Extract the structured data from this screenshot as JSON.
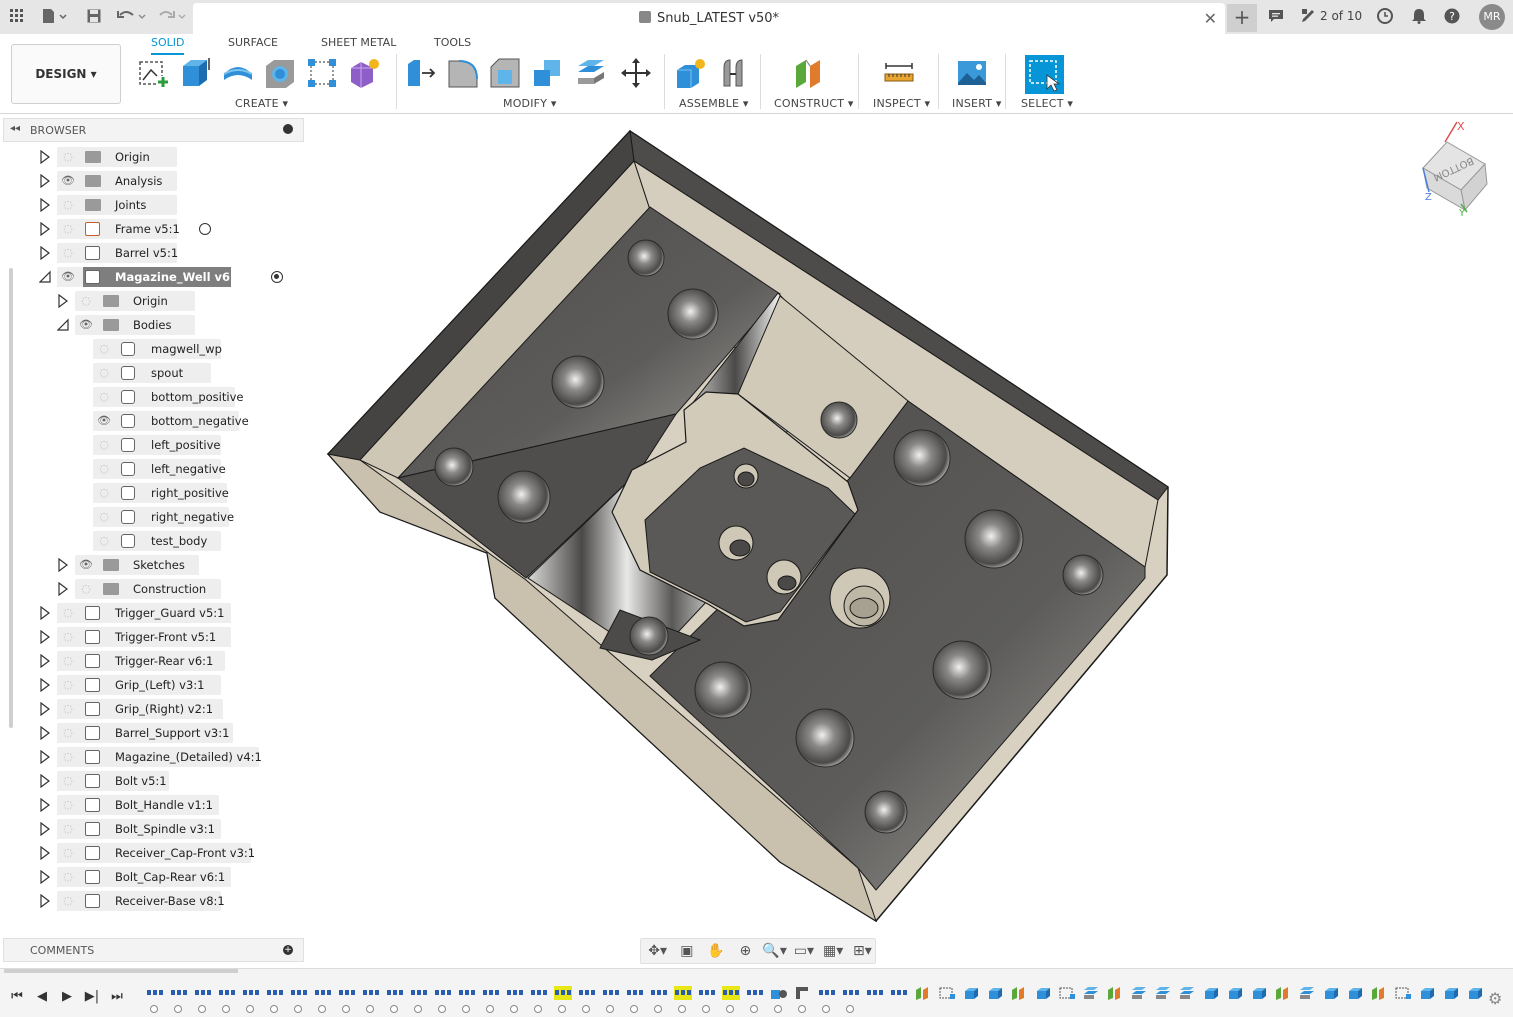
{
  "titlebar": {
    "doc_title": "Snub_LATEST v50*",
    "page_count": "2 of 10",
    "avatar_initials": "MR"
  },
  "ribbon": {
    "workspace": "DESIGN",
    "tabs": [
      "SOLID",
      "SURFACE",
      "SHEET METAL",
      "TOOLS"
    ],
    "active_tab": "SOLID",
    "groups": {
      "create": "CREATE",
      "modify": "MODIFY",
      "assemble": "ASSEMBLE",
      "construct": "CONSTRUCT",
      "inspect": "INSPECT",
      "insert": "INSERT",
      "select": "SELECT"
    }
  },
  "browser": {
    "title": "BROWSER",
    "items": [
      {
        "label": "Origin",
        "icon": "folder",
        "visible": false
      },
      {
        "label": "Analysis",
        "icon": "folder",
        "visible": true
      },
      {
        "label": "Joints",
        "icon": "folder",
        "visible": false
      },
      {
        "label": "Frame v5:1",
        "icon": "component-linked",
        "visible": false
      },
      {
        "label": "Barrel v5:1",
        "icon": "component",
        "visible": false
      },
      {
        "label": "Magazine_Well v6:1",
        "icon": "component",
        "visible": true,
        "active": true
      },
      {
        "label": "Origin",
        "icon": "folder",
        "visible": false
      },
      {
        "label": "Bodies",
        "icon": "folder",
        "visible": true
      },
      {
        "label": "magwell_wp",
        "icon": "body",
        "visible": false
      },
      {
        "label": "spout",
        "icon": "body",
        "visible": false
      },
      {
        "label": "bottom_positive",
        "icon": "body",
        "visible": false
      },
      {
        "label": "bottom_negative",
        "icon": "body",
        "visible": true
      },
      {
        "label": "left_positive",
        "icon": "body",
        "visible": false
      },
      {
        "label": "left_negative",
        "icon": "body",
        "visible": false
      },
      {
        "label": "right_positive",
        "icon": "body",
        "visible": false
      },
      {
        "label": "right_negative",
        "icon": "body",
        "visible": false
      },
      {
        "label": "test_body",
        "icon": "body",
        "visible": false
      },
      {
        "label": "Sketches",
        "icon": "folder",
        "visible": true
      },
      {
        "label": "Construction",
        "icon": "folder",
        "visible": false
      },
      {
        "label": "Trigger_Guard v5:1",
        "icon": "component",
        "visible": false
      },
      {
        "label": "Trigger-Front v5:1",
        "icon": "component",
        "visible": false
      },
      {
        "label": "Trigger-Rear v6:1",
        "icon": "component",
        "visible": false
      },
      {
        "label": "Grip_(Left) v3:1",
        "icon": "component",
        "visible": false
      },
      {
        "label": "Grip_(Right) v2:1",
        "icon": "component",
        "visible": false
      },
      {
        "label": "Barrel_Support v3:1",
        "icon": "component",
        "visible": false
      },
      {
        "label": "Magazine_(Detailed) v4:1",
        "icon": "component",
        "visible": false
      },
      {
        "label": "Bolt v5:1",
        "icon": "component",
        "visible": false
      },
      {
        "label": "Bolt_Handle v1:1",
        "icon": "component",
        "visible": false
      },
      {
        "label": "Bolt_Spindle v3:1",
        "icon": "component",
        "visible": false
      },
      {
        "label": "Receiver_Cap-Front v3:1",
        "icon": "component",
        "visible": false
      },
      {
        "label": "Bolt_Cap-Rear v6:1",
        "icon": "component",
        "visible": false
      },
      {
        "label": "Receiver-Base v8:1",
        "icon": "component",
        "visible": false
      }
    ]
  },
  "comments": {
    "title": "COMMENTS"
  },
  "viewcube": {
    "face": "BOTTOM",
    "axis_x": "X",
    "axis_y": "Y",
    "axis_z": "Z"
  },
  "colors": {
    "accent": "#0696d7",
    "model_dark": "#5a5957",
    "model_tan": "#d8d0c0",
    "timeline_highlight": "#e8e817"
  }
}
